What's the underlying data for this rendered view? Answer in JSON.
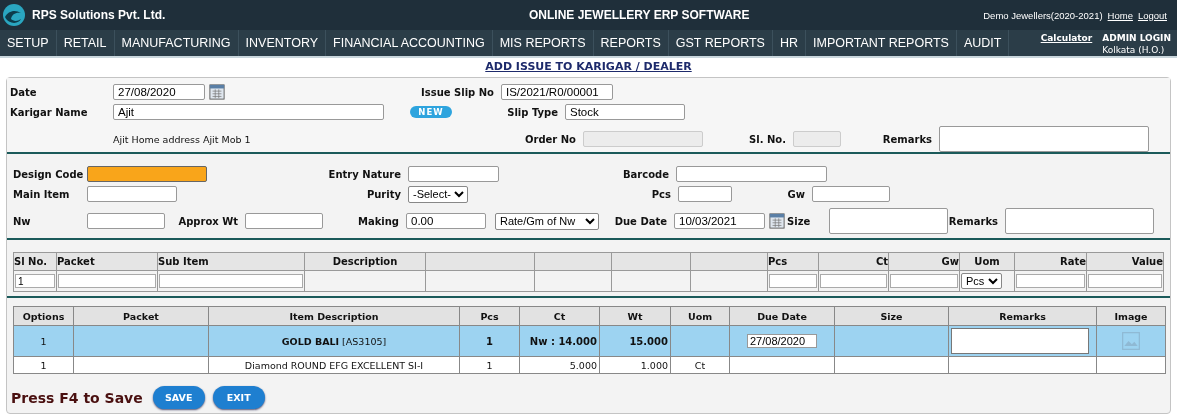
{
  "header": {
    "company": "RPS Solutions Pvt. Ltd.",
    "title": "ONLINE JEWELLERY ERP SOFTWARE",
    "account": "Demo Jewellers(2020-2021)",
    "links": [
      "Home",
      "Logout"
    ]
  },
  "nav": {
    "menus": [
      "SETUP",
      "RETAIL",
      "MANUFACTURING",
      "INVENTORY",
      "FINANCIAL ACCOUNTING",
      "MIS REPORTS",
      "REPORTS",
      "GST REPORTS",
      "HR",
      "IMPORTANT REPORTS",
      "AUDIT"
    ],
    "calculator": "Calculator",
    "login": "ADMIN LOGIN",
    "branch": "Kolkata (H.O.)"
  },
  "page_title": "ADD ISSUE TO KARIGAR / DEALER",
  "issue": {
    "date": {
      "label": "Date",
      "value": "27/08/2020"
    },
    "karigar": {
      "label": "Karigar Name",
      "value": "Ajit"
    },
    "new_button": "NEW",
    "address": "Ajit Home address Ajit Mob 1",
    "slip_no": {
      "label": "Issue Slip No",
      "value": "IS/2021/R0/00001"
    },
    "slip_type": {
      "label": "Slip Type",
      "value": "Stock"
    },
    "order_no": {
      "label": "Order No",
      "disabled": true
    },
    "sl_no": {
      "label": "Sl. No.",
      "disabled": true
    },
    "remarks": {
      "label": "Remarks"
    }
  },
  "design": {
    "design_code": {
      "label": "Design Code",
      "highlighted": true
    },
    "entry_nature": {
      "label": "Entry Nature"
    },
    "barcode": {
      "label": "Barcode"
    },
    "main_item": {
      "label": "Main Item"
    },
    "purity": {
      "label": "Purity",
      "value": "-Select-"
    },
    "pcs": {
      "label": "Pcs"
    },
    "gw": {
      "label": "Gw"
    },
    "nw": {
      "label": "Nw"
    },
    "approx_wt": {
      "label": "Approx Wt"
    },
    "making": {
      "label": "Making",
      "value": "0.00"
    },
    "making_basis": {
      "value": "Rate/Gm of Nw"
    },
    "due_date": {
      "label": "Due Date",
      "value": "10/03/2021"
    },
    "size": {
      "label": "Size"
    },
    "remarks": {
      "label": "Remarks"
    }
  },
  "entry_table": {
    "columns": [
      {
        "label": "Sl No."
      },
      {
        "label": "Packet"
      },
      {
        "label": "Sub Item"
      },
      {
        "label": "Description"
      },
      {},
      {},
      {},
      {},
      {
        "label": "Pcs"
      },
      {
        "label": "Ct"
      },
      {
        "label": "Gw"
      },
      {
        "label": "Uom"
      },
      {
        "label": "Rate"
      },
      {
        "label": "Value"
      }
    ],
    "row": [
      {
        "kind": "input",
        "value": "1"
      },
      {
        "kind": "input"
      },
      {
        "kind": "input"
      },
      {
        "kind": "blank"
      },
      {
        "kind": "blank"
      },
      {
        "kind": "blank"
      },
      {
        "kind": "blank"
      },
      {
        "kind": "blank"
      },
      {
        "kind": "input"
      },
      {
        "kind": "input"
      },
      {
        "kind": "input"
      },
      {
        "kind": "select",
        "value": "Pcs"
      },
      {
        "kind": "input"
      },
      {
        "kind": "input"
      }
    ]
  },
  "items_table": {
    "columns": [
      "Options",
      "Packet",
      "Item Description",
      "Pcs",
      "Ct",
      "Wt",
      "Uom",
      "Due Date",
      "Size",
      "Remarks",
      "Image"
    ],
    "rows": [
      {
        "selected": true,
        "cells": [
          {
            "kind": "text",
            "text": "1"
          },
          {
            "kind": "blank"
          },
          {
            "kind": "text",
            "text": "**GOLD BALI** [AS3105]"
          },
          {
            "kind": "text",
            "text": "1",
            "bold": true
          },
          {
            "kind": "text",
            "text": "Nw : 14.000",
            "bold": true
          },
          {
            "kind": "text",
            "text": "15.000",
            "bold": true
          },
          {
            "kind": "blank"
          },
          {
            "kind": "input",
            "value": "27/08/2020"
          },
          {
            "kind": "blank"
          },
          {
            "kind": "textarea"
          },
          {
            "kind": "image"
          }
        ]
      },
      {
        "selected": false,
        "cells": [
          {
            "kind": "text",
            "text": "1"
          },
          {
            "kind": "blank"
          },
          {
            "kind": "text",
            "text": "Diamond ROUND EFG EXCELLENT SI-I"
          },
          {
            "kind": "text",
            "text": "1"
          },
          {
            "kind": "text",
            "text": "5.000"
          },
          {
            "kind": "text",
            "text": "1.000"
          },
          {
            "kind": "text",
            "text": "Ct"
          },
          {
            "kind": "blank"
          },
          {
            "kind": "blank"
          },
          {
            "kind": "blank"
          },
          {
            "kind": "blank"
          }
        ]
      }
    ]
  },
  "footer": {
    "hint": "Press F4 to Save",
    "buttons": [
      "SAVE",
      "EXIT"
    ]
  }
}
